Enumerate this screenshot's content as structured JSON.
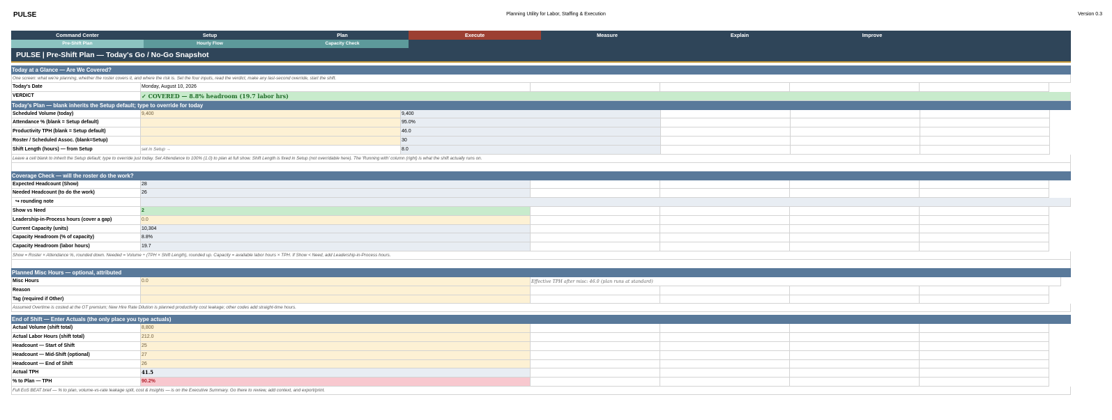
{
  "app": {
    "name": "PULSE",
    "subtitle": "Planning Utility for Labor, Staffing & Execution",
    "version": "Version 0.3"
  },
  "nav": {
    "tabs": [
      "Command Center",
      "Setup",
      "Plan",
      "Execute",
      "Measure",
      "Explain",
      "Improve"
    ],
    "active_tab": "Execute",
    "subtabs": [
      "Pre-Shift Plan",
      "Hourly Flow",
      "Capacity Check"
    ],
    "active_subtab": "Pre-Shift Plan"
  },
  "page_title": "PULSE | Pre-Shift Plan  —  Today's Go / No-Go Snapshot",
  "glance": {
    "header": "Today at a Glance  —  Are We Covered?",
    "note": "One screen: what we're planning, whether the roster covers it, and where the risk is. Set the four inputs, read the verdict, make any last-second override, start the shift.",
    "date_label": "Today's Date",
    "date_value": "Monday, August 10, 2026",
    "verdict_label": "VERDICT",
    "verdict_value": "✓ COVERED  —  8.8% headroom (19.7 labor hrs)"
  },
  "plan": {
    "header": "Today's Plan  —  blank inherits the Setup default; type to override for today",
    "rows": [
      {
        "label": "Scheduled Volume (today)",
        "input": "9,400",
        "running": "9,400"
      },
      {
        "label": "Attendance %  (blank = Setup default)",
        "input": "",
        "running": "95.0%"
      },
      {
        "label": "Productivity TPH  (blank = Setup default)",
        "input": "",
        "running": "46.0"
      },
      {
        "label": "Roster / Scheduled Assoc. (blank=Setup)",
        "input": "",
        "running": "30"
      },
      {
        "label": "Shift Length (hours)  —  from Setup",
        "input": "set in Setup →",
        "running": "8.0"
      }
    ],
    "note": "Leave a cell blank to inherit the Setup default; type to override just today. Set Attendance to 100% (1.0) to plan at full show. Shift Length is fixed in Setup (not overridable here). The 'Running with' column (right) is what the shift actually runs on."
  },
  "coverage": {
    "header": "Coverage Check  —  will the roster do the work?",
    "expected_label": "Expected Headcount (Show)",
    "expected_value": "28",
    "needed_label": "Needed Headcount (to do the work)",
    "needed_value": "26",
    "rounding_label": "↪ rounding note",
    "rounding_value": "",
    "show_label": "Show vs Need",
    "show_value": "2",
    "lip_label": "Leadership-in-Process hours (cover a gap)",
    "lip_value": "0.0",
    "capacity_label": "Current Capacity (units)",
    "capacity_value": "10,304",
    "headroom_pct_label": "Capacity Headroom (% of capacity)",
    "headroom_pct_value": "8.8%",
    "headroom_hrs_label": "Capacity Headroom (labor hours)",
    "headroom_hrs_value": "19.7",
    "note": "Show = Roster × Attendance %, rounded down. Needed = Volume ÷ (TPH × Shift Length), rounded up. Capacity = available labor hours × TPH. If Show < Need, add Leadership-in-Process hours."
  },
  "misc": {
    "header": "Planned Misc Hours  —  optional, attributed",
    "hours_label": "Misc Hours",
    "hours_value": "0.0",
    "effective_tph": "Effective TPH after misc: 46.0  (plan runs at standard)",
    "reason_label": "Reason",
    "reason_value": "",
    "tag_label": "Tag (required if Other)",
    "tag_value": "",
    "note": "Assumed Overtime is costed at the OT premium; New Hire Rate Dilution is planned productivity cost leakage; other codes add straight-time hours."
  },
  "eos": {
    "header": "End of Shift  —  Enter Actuals  (the only place you type actuals)",
    "actual_volume_label": "Actual Volume (shift total)",
    "actual_volume_value": "8,800",
    "actual_hours_label": "Actual Labor Hours (shift total)",
    "actual_hours_value": "212.0",
    "hc_start_label": "Headcount — Start of Shift",
    "hc_start_value": "25",
    "hc_mid_label": "Headcount — Mid-Shift (optional)",
    "hc_mid_value": "27",
    "hc_end_label": "Headcount — End of Shift",
    "hc_end_value": "26",
    "actual_tph_label": "Actual TPH",
    "actual_tph_value": "41.5",
    "pct_plan_label": "% to Plan — TPH",
    "pct_plan_value": "90.2%",
    "note": "Full EoS BEAT brief — % to plan, volume-vs-rate leakage split, cost & insights — is on the Executive Summary. Go there to review, add context, and export/print."
  },
  "colors": {
    "nav_bg": "#2f4559",
    "active_tab": "#9c3f32",
    "section_header": "#59799a",
    "input_fill": "#fdf1d4",
    "calc_fill": "#e8edf3",
    "good_fill": "#c8ebcc",
    "bad_fill": "#f8c8cf"
  }
}
